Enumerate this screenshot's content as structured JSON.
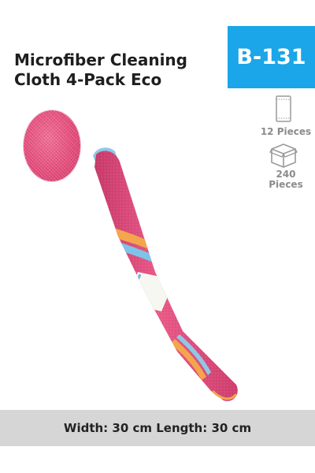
{
  "product": {
    "title_line1": "Microfiber Cleaning",
    "title_line2": "Cloth 4-Pack Eco",
    "code": "B-131"
  },
  "packaging": {
    "pack_label": "12 Pieces",
    "box_qty": "240",
    "box_unit": "Pieces",
    "pack_icon": "package-icon",
    "box_icon": "box-icon"
  },
  "dimensions": {
    "text": "Width: 30 cm Length: 30 cm"
  },
  "colors": {
    "accent": "#1aa6e8",
    "cloth": "#e4507f",
    "bar": "#d6d6d6"
  }
}
